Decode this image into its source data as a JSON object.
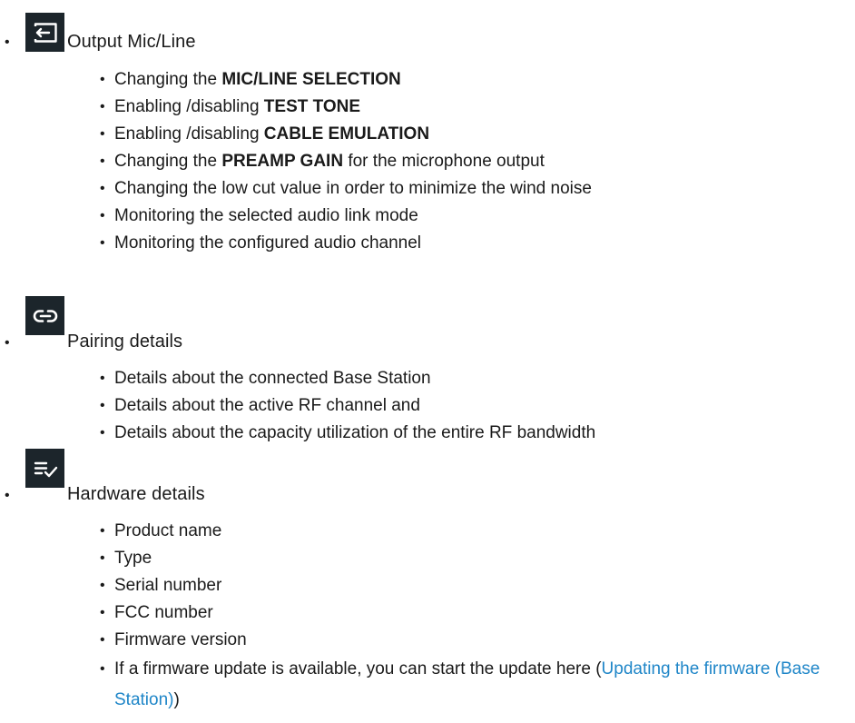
{
  "sections": [
    {
      "title": "Output Mic/Line",
      "icon": "output-icon",
      "items": [
        {
          "pre": "Changing the ",
          "bold": "MIC/LINE SELECTION",
          "post": ""
        },
        {
          "pre": "Enabling /disabling ",
          "bold": "TEST TONE",
          "post": ""
        },
        {
          "pre": "Enabling /disabling ",
          "bold": "CABLE EMULATION",
          "post": ""
        },
        {
          "pre": "Changing the ",
          "bold": "PREAMP GAIN",
          "post": " for the microphone output"
        },
        {
          "pre": "Changing the low cut value in order to minimize the wind noise",
          "bold": "",
          "post": ""
        },
        {
          "pre": "Monitoring the selected audio link mode",
          "bold": "",
          "post": ""
        },
        {
          "pre": "Monitoring the configured audio channel",
          "bold": "",
          "post": ""
        }
      ]
    },
    {
      "title": "Pairing details",
      "icon": "link-icon",
      "items": [
        "Details about the connected Base Station",
        "Details about the active RF channel and",
        "Details about the capacity utilization of the entire RF bandwidth"
      ]
    },
    {
      "title": "Hardware details",
      "icon": "list-check-icon",
      "items": [
        "Product name",
        "Type",
        "Serial number",
        "FCC number",
        "Firmware version"
      ],
      "last_item": {
        "pre": "If a firmware update is available, you can start the update here (",
        "link": "Updating the firmware (Base Station)",
        "post": ")"
      }
    }
  ],
  "colors": {
    "icon_bg": "#1c252b",
    "link": "#1f86c8",
    "text": "#1a1a1a"
  }
}
